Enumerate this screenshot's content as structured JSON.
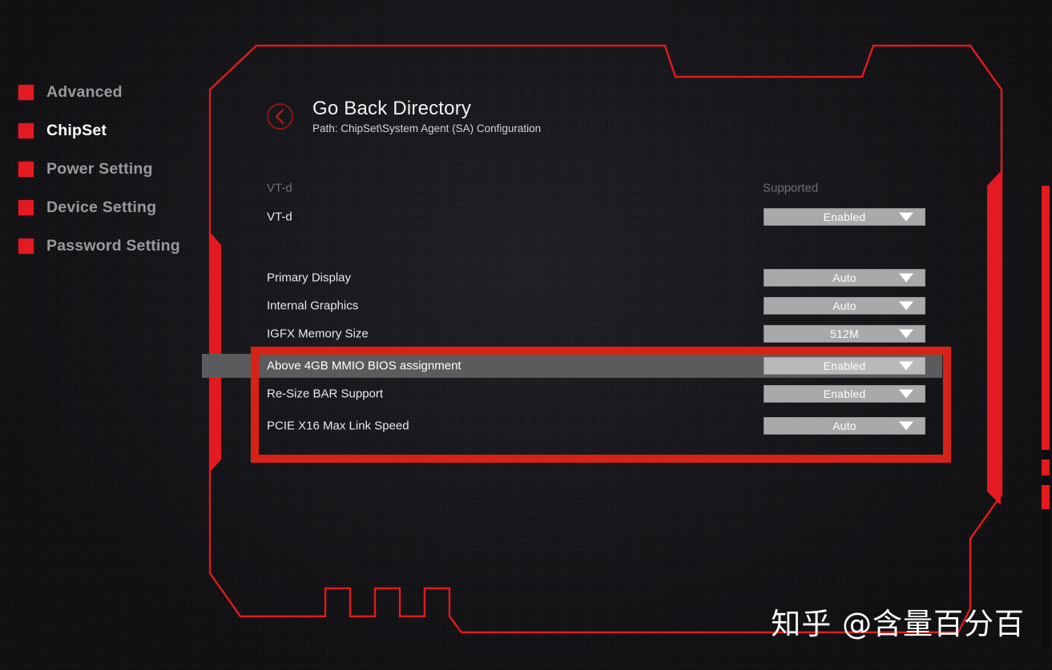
{
  "sidebar": {
    "items": [
      {
        "label": "Advanced",
        "active": false
      },
      {
        "label": "ChipSet",
        "active": true
      },
      {
        "label": "Power Setting",
        "active": false
      },
      {
        "label": "Device Setting",
        "active": false
      },
      {
        "label": "Password Setting",
        "active": false
      }
    ]
  },
  "header": {
    "back_title": "Go Back Directory",
    "path": "Path: ChipSet\\System Agent (SA) Configuration",
    "back_icon": "chevron-left-circle-icon"
  },
  "settings": [
    {
      "label": "VT-d",
      "type": "info",
      "value": "Supported",
      "dim": true,
      "selected": false
    },
    {
      "label": "VT-d",
      "type": "dropdown",
      "value": "Enabled",
      "dim": false,
      "selected": false
    },
    {
      "label": "Primary Display",
      "type": "dropdown",
      "value": "Auto",
      "dim": false,
      "selected": false
    },
    {
      "label": "Internal Graphics",
      "type": "dropdown",
      "value": "Auto",
      "dim": false,
      "selected": false
    },
    {
      "label": "IGFX Memory Size",
      "type": "dropdown",
      "value": "512M",
      "dim": false,
      "selected": false
    },
    {
      "label": "Above 4GB MMIO BIOS assignment",
      "type": "dropdown",
      "value": "Enabled",
      "dim": false,
      "selected": true
    },
    {
      "label": "Re-Size BAR Support",
      "type": "dropdown",
      "value": "Enabled",
      "dim": false,
      "selected": false
    },
    {
      "label": "PCIE X16 Max Link Speed",
      "type": "dropdown",
      "value": "Auto",
      "dim": false,
      "selected": false
    }
  ],
  "watermark": "知乎 @含量百分百",
  "colors": {
    "accent_red": "#e31a21",
    "highlight_box_red": "#d92217",
    "frame_red": "#e01b1b",
    "dropdown_bg": "#a9a9ac",
    "selected_row_bg": "#5b5b5d",
    "active_text": "#ffffff",
    "inactive_text": "#9a9a9e"
  }
}
